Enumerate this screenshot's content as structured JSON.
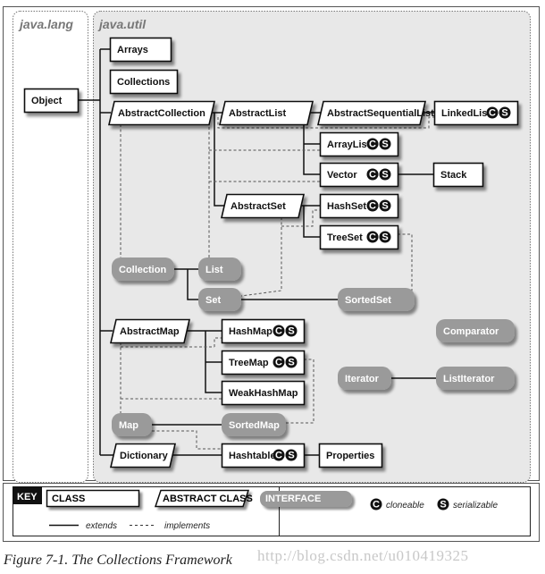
{
  "packages": {
    "lang": "java.lang",
    "util": "java.util"
  },
  "nodes": {
    "Object": {
      "label": "Object",
      "kind": "class",
      "cloneable": false,
      "serializable": false
    },
    "Arrays": {
      "label": "Arrays",
      "kind": "class",
      "cloneable": false,
      "serializable": false
    },
    "Collections": {
      "label": "Collections",
      "kind": "class",
      "cloneable": false,
      "serializable": false
    },
    "AbstractCollection": {
      "label": "AbstractCollection",
      "kind": "abstract",
      "cloneable": false,
      "serializable": false
    },
    "AbstractList": {
      "label": "AbstractList",
      "kind": "abstract",
      "cloneable": false,
      "serializable": false
    },
    "AbstractSequentialList": {
      "label": "AbstractSequentialList",
      "kind": "abstract",
      "cloneable": false,
      "serializable": false
    },
    "LinkedList": {
      "label": "LinkedList",
      "kind": "class",
      "cloneable": true,
      "serializable": true
    },
    "ArrayList": {
      "label": "ArrayList",
      "kind": "class",
      "cloneable": true,
      "serializable": true
    },
    "Vector": {
      "label": "Vector",
      "kind": "class",
      "cloneable": true,
      "serializable": true
    },
    "Stack": {
      "label": "Stack",
      "kind": "class",
      "cloneable": false,
      "serializable": false
    },
    "AbstractSet": {
      "label": "AbstractSet",
      "kind": "abstract",
      "cloneable": false,
      "serializable": false
    },
    "HashSet": {
      "label": "HashSet",
      "kind": "class",
      "cloneable": true,
      "serializable": true
    },
    "TreeSet": {
      "label": "TreeSet",
      "kind": "class",
      "cloneable": true,
      "serializable": true
    },
    "Collection": {
      "label": "Collection",
      "kind": "interface"
    },
    "List": {
      "label": "List",
      "kind": "interface"
    },
    "Set": {
      "label": "Set",
      "kind": "interface"
    },
    "SortedSet": {
      "label": "SortedSet",
      "kind": "interface"
    },
    "AbstractMap": {
      "label": "AbstractMap",
      "kind": "abstract",
      "cloneable": false,
      "serializable": false
    },
    "HashMap": {
      "label": "HashMap",
      "kind": "class",
      "cloneable": true,
      "serializable": true
    },
    "TreeMap": {
      "label": "TreeMap",
      "kind": "class",
      "cloneable": true,
      "serializable": true
    },
    "WeakHashMap": {
      "label": "WeakHashMap",
      "kind": "class",
      "cloneable": false,
      "serializable": false
    },
    "Comparator": {
      "label": "Comparator",
      "kind": "interface"
    },
    "Iterator": {
      "label": "Iterator",
      "kind": "interface"
    },
    "ListIterator": {
      "label": "ListIterator",
      "kind": "interface"
    },
    "Map": {
      "label": "Map",
      "kind": "interface"
    },
    "SortedMap": {
      "label": "SortedMap",
      "kind": "interface"
    },
    "Dictionary": {
      "label": "Dictionary",
      "kind": "abstract",
      "cloneable": false,
      "serializable": false
    },
    "Hashtable": {
      "label": "Hashtable",
      "kind": "class",
      "cloneable": true,
      "serializable": true
    },
    "Properties": {
      "label": "Properties",
      "kind": "class",
      "cloneable": false,
      "serializable": false
    }
  },
  "extends": [
    [
      "Object",
      "Arrays"
    ],
    [
      "Object",
      "Collections"
    ],
    [
      "Object",
      "AbstractCollection"
    ],
    [
      "Object",
      "AbstractMap"
    ],
    [
      "Object",
      "Dictionary"
    ],
    [
      "AbstractCollection",
      "AbstractList"
    ],
    [
      "AbstractCollection",
      "AbstractSet"
    ],
    [
      "AbstractList",
      "AbstractSequentialList"
    ],
    [
      "AbstractList",
      "ArrayList"
    ],
    [
      "AbstractList",
      "Vector"
    ],
    [
      "AbstractSequentialList",
      "LinkedList"
    ],
    [
      "Vector",
      "Stack"
    ],
    [
      "AbstractSet",
      "HashSet"
    ],
    [
      "AbstractSet",
      "TreeSet"
    ],
    [
      "Collection",
      "List"
    ],
    [
      "Collection",
      "Set"
    ],
    [
      "Set",
      "SortedSet"
    ],
    [
      "AbstractMap",
      "HashMap"
    ],
    [
      "AbstractMap",
      "TreeMap"
    ],
    [
      "AbstractMap",
      "WeakHashMap"
    ],
    [
      "Map",
      "SortedMap"
    ],
    [
      "Iterator",
      "ListIterator"
    ],
    [
      "Dictionary",
      "Hashtable"
    ],
    [
      "Hashtable",
      "Properties"
    ]
  ],
  "implements": [
    [
      "AbstractCollection",
      "Collection"
    ],
    [
      "AbstractList",
      "List"
    ],
    [
      "LinkedList",
      "List"
    ],
    [
      "ArrayList",
      "List"
    ],
    [
      "Vector",
      "List"
    ],
    [
      "AbstractSet",
      "Set"
    ],
    [
      "HashSet",
      "Set"
    ],
    [
      "TreeSet",
      "SortedSet"
    ],
    [
      "AbstractMap",
      "Map"
    ],
    [
      "HashMap",
      "Map"
    ],
    [
      "WeakHashMap",
      "Map"
    ],
    [
      "TreeMap",
      "SortedMap"
    ],
    [
      "Hashtable",
      "Map"
    ]
  ],
  "badges": {
    "cloneable": "C",
    "serializable": "S"
  },
  "key": {
    "title": "KEY",
    "class": "CLASS",
    "abstract_class": "ABSTRACT CLASS",
    "interface": "INTERFACE",
    "cloneable": "cloneable",
    "serializable": "serializable",
    "extends": "extends",
    "implements": "implements"
  },
  "caption": "Figure 7-1. The Collections Framework",
  "watermark": "http://blog.csdn.net/u010419325",
  "colors": {
    "util_bg": "#e8e8e8",
    "interface_fill": "#9a9a9a",
    "box_stroke": "#111111",
    "badge": "#111111"
  }
}
